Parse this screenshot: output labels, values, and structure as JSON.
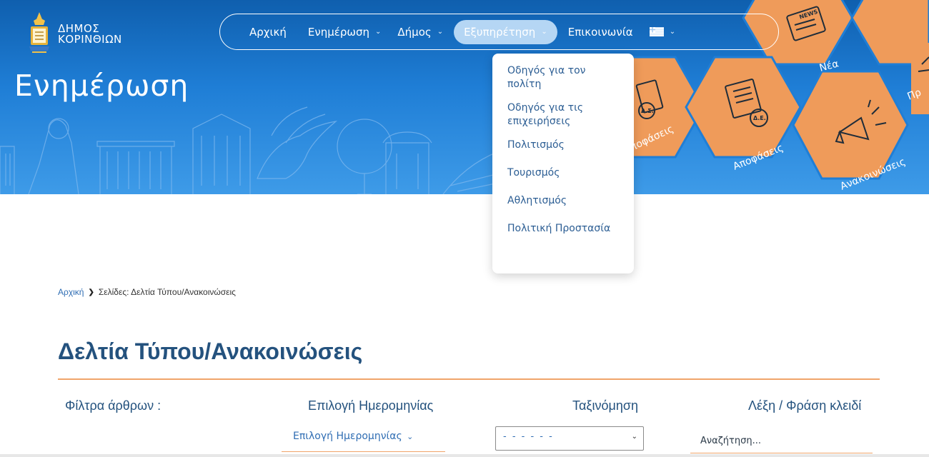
{
  "logo": {
    "line1": "ΔΗΜΟΣ",
    "line2": "ΚΟΡΙΝΘΙΩΝ"
  },
  "hero": {
    "title": "Ενημέρωση",
    "tiles": [
      "Αποφάσεις",
      "Αποφάσεις",
      "Νέα",
      "Ανακοινώσεις",
      "Πρ"
    ],
    "tile_badges": [
      "NEWS",
      "Δ.Σ.",
      "Δ.Ε."
    ]
  },
  "nav": {
    "items": [
      {
        "label": "Αρχική",
        "has_dropdown": false
      },
      {
        "label": "Ενημέρωση",
        "has_dropdown": true
      },
      {
        "label": "Δήμος",
        "has_dropdown": true
      },
      {
        "label": "Εξυπηρέτηση",
        "has_dropdown": true,
        "active": true
      },
      {
        "label": "Επικοινωνία",
        "has_dropdown": false
      }
    ],
    "language_icon": "greek-flag-icon"
  },
  "dropdown": {
    "items": [
      "Οδηγός για τον πολίτη",
      "Οδηγός για τις επιχειρήσεις",
      "Πολιτισμός",
      "Τουρισμός",
      "Αθλητισμός",
      "Πολιτική Προστασία"
    ]
  },
  "breadcrumb": {
    "home": "Αρχική",
    "separator": "❯",
    "current": "Σελίδες: Δελτία Τύπου/Ανακοινώσεις"
  },
  "page": {
    "title": "Δελτία Τύπου/Ανακοινώσεις"
  },
  "filters": {
    "label": "Φίλτρα άρθρων :",
    "date_label": "Επιλογή Ημερομηνίας",
    "date_value": "Επιλογή Ημερομηνίας",
    "sort_label": "Ταξινόμηση",
    "sort_value": "- - - - - -",
    "keyword_label": "Λέξη / Φράση κλειδί",
    "keyword_placeholder": "Αναζήτηση..."
  },
  "colors": {
    "accent_orange": "#f0a46a",
    "tile_orange": "#ef9b5a",
    "brand_blue": "#24527e",
    "hero_blue": "#1f7ed6"
  }
}
